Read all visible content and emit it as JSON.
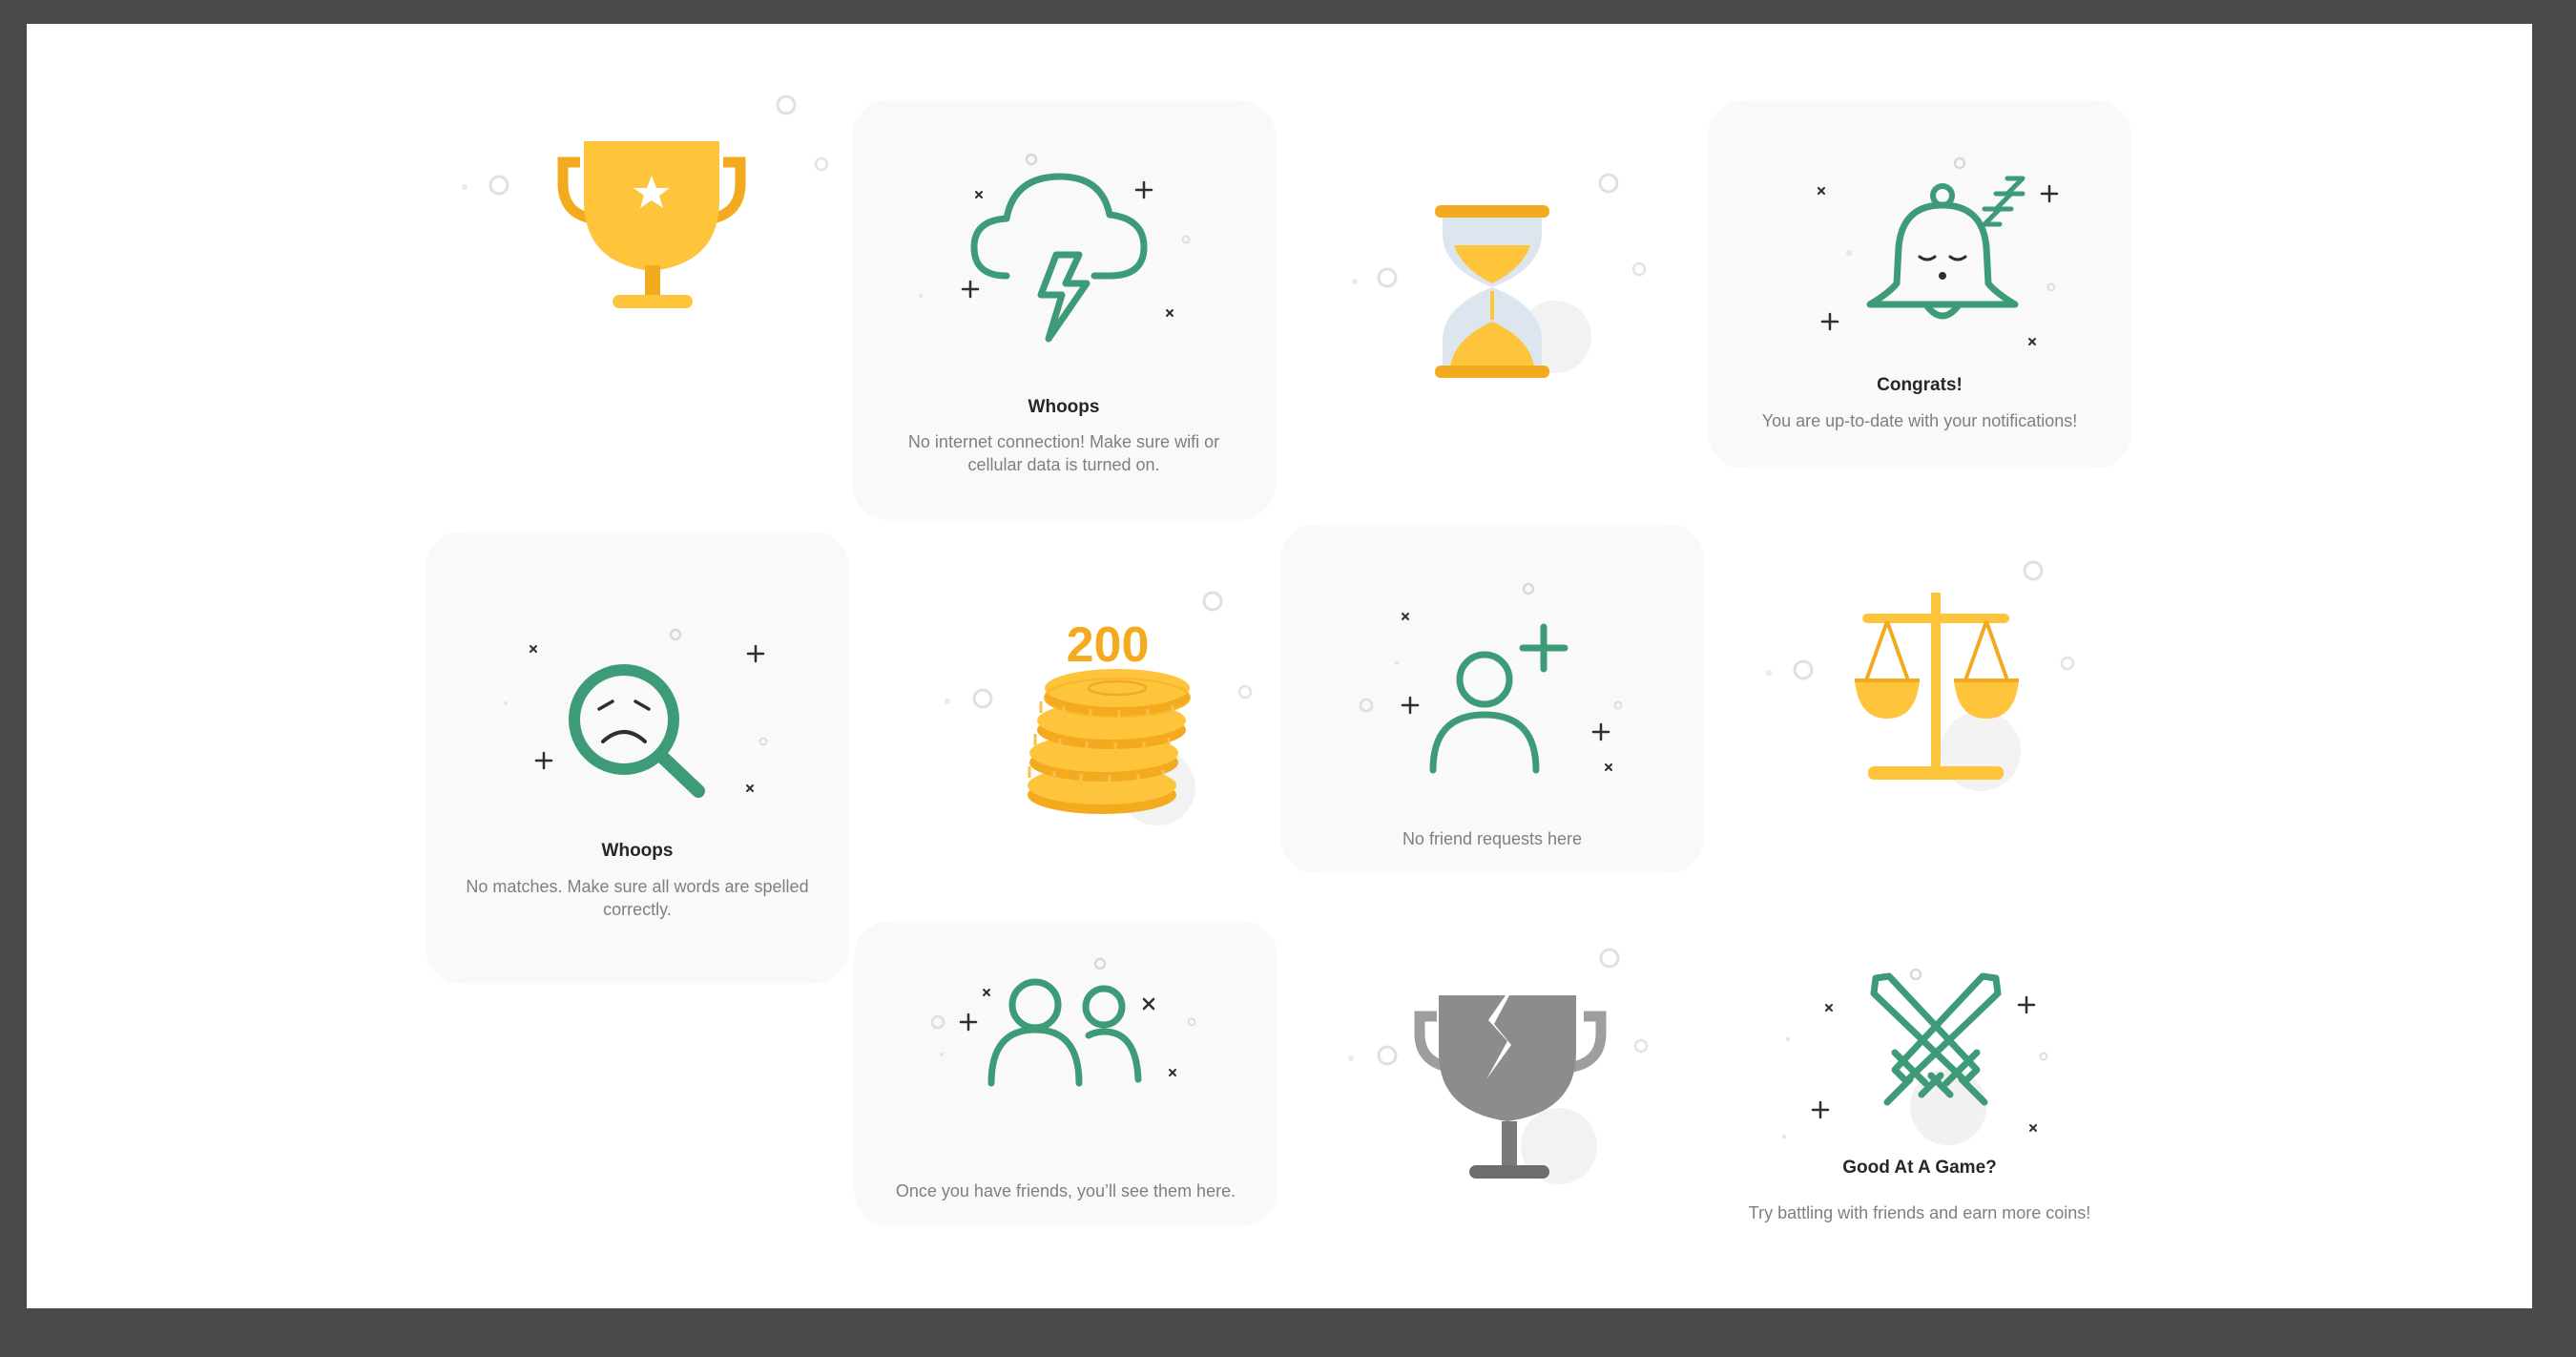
{
  "colors": {
    "green": "#3d9b78",
    "gold": "#fdc43c",
    "gold_dark": "#f3aa1f",
    "gray": "#8c8c8c",
    "card_bg": "#f9f9f9",
    "title_text": "#262626",
    "desc_text": "#7f7f7f"
  },
  "cards": [
    {
      "id": "trophy",
      "icon": "trophy-icon"
    },
    {
      "id": "no-internet",
      "icon": "storm-cloud-icon",
      "title": "Whoops",
      "description": "No internet connection! Make sure  wifi or cellular data is turned on."
    },
    {
      "id": "hourglass",
      "icon": "hourglass-icon"
    },
    {
      "id": "notifications",
      "icon": "sleeping-bell-icon",
      "title": "Congrats!",
      "description": "You are up-to-date with your notifications!"
    },
    {
      "id": "no-matches",
      "icon": "sad-magnifier-icon",
      "title": "Whoops",
      "description": "No matches. Make sure all words are spelled correctly."
    },
    {
      "id": "coins",
      "icon": "coin-stack-icon",
      "amount": "200"
    },
    {
      "id": "friend-requests",
      "icon": "add-user-icon",
      "description": "No friend requests here"
    },
    {
      "id": "scales",
      "icon": "balance-scale-icon"
    },
    {
      "id": "friends",
      "icon": "users-icon",
      "description": "Once you have friends, you’ll see them here."
    },
    {
      "id": "broken-trophy",
      "icon": "broken-trophy-icon"
    },
    {
      "id": "game",
      "icon": "crossed-swords-icon",
      "title": "Good At A Game?",
      "description": "Try battling with friends and earn more coins!"
    }
  ]
}
